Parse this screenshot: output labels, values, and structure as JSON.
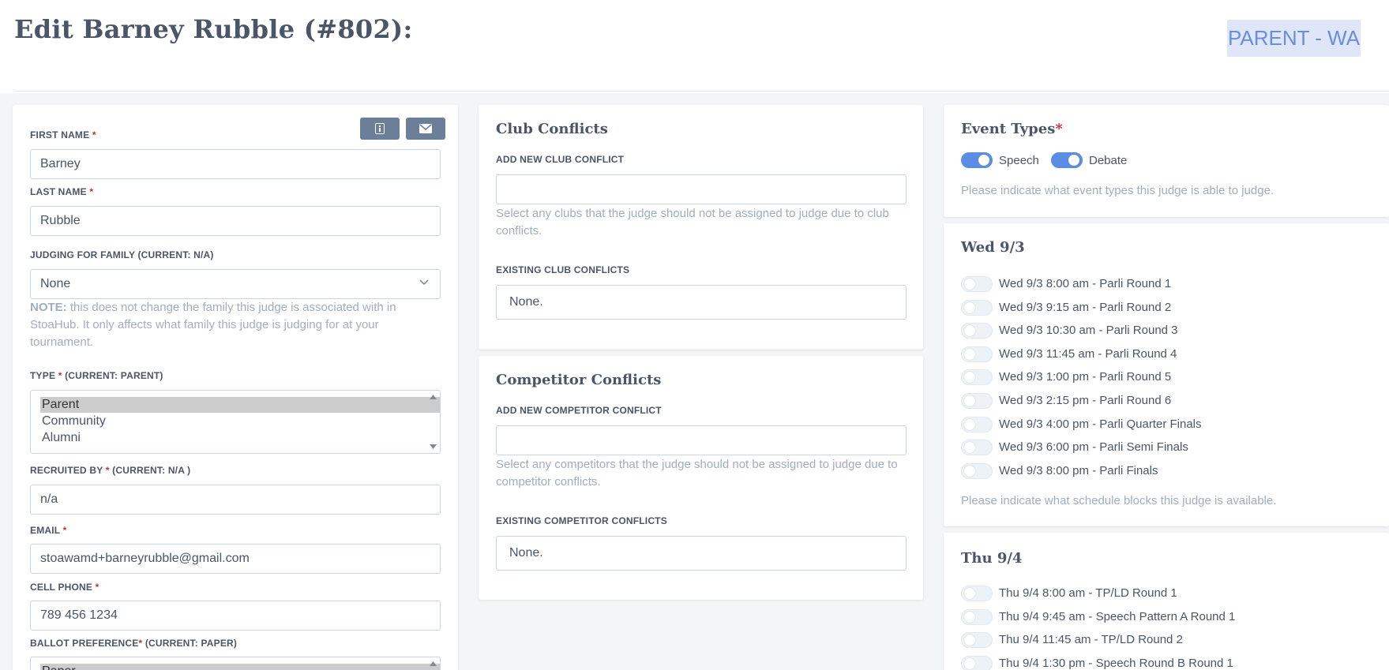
{
  "header": {
    "title": "Edit Barney Rubble (#802):",
    "badge": "PARENT - WA"
  },
  "judge_form": {
    "first_name": {
      "label": "FIRST NAME",
      "required": "*",
      "value": "Barney"
    },
    "last_name": {
      "label": "LAST NAME",
      "required": "*",
      "value": "Rubble"
    },
    "family": {
      "label": "JUDGING FOR FAMILY (CURRENT: N/A)",
      "value": "None"
    },
    "note": {
      "prefix": "NOTE:",
      "text": " this does not change the family this judge is associated with in StoaHub. It only affects what family this judge is judging for at your tournament."
    },
    "type": {
      "label": "TYPE",
      "required": "*",
      "current": " (CURRENT: PARENT)",
      "options": [
        "Parent",
        "Community",
        "Alumni"
      ],
      "selected": "Parent"
    },
    "recruited_by": {
      "label": "RECRUITED BY",
      "required": "*",
      "current": " (CURRENT: N/A )",
      "value": "n/a"
    },
    "email": {
      "label": "EMAIL",
      "required": "*",
      "value": "stoawamd+barneyrubble@gmail.com"
    },
    "cell_phone": {
      "label": "CELL PHONE",
      "required": "*",
      "value": "789 456 1234"
    },
    "ballot_preference": {
      "label": "BALLOT PREFERENCE",
      "required": "*",
      "current": " (CURRENT: PAPER)",
      "selected": "Paper"
    },
    "buttons": {
      "info_icon": "info-icon",
      "mail_icon": "mail-icon"
    }
  },
  "club_conflicts": {
    "title": "Club Conflicts",
    "add_label": "ADD NEW CLUB CONFLICT",
    "add_value": "",
    "help": "Select any clubs that the judge should not be assigned to judge due to club conflicts.",
    "existing_label": "EXISTING CLUB CONFLICTS",
    "existing_value": "None."
  },
  "competitor_conflicts": {
    "title": "Competitor Conflicts",
    "add_label": "ADD NEW COMPETITOR CONFLICT",
    "add_value": "",
    "help": "Select any competitors that the judge should not be assigned to judge due to competitor conflicts.",
    "existing_label": "EXISTING COMPETITOR CONFLICTS",
    "existing_value": "None."
  },
  "event_types": {
    "title": "Event Types",
    "required": "*",
    "items": [
      {
        "label": "Speech",
        "on": true
      },
      {
        "label": "Debate",
        "on": true
      }
    ],
    "help": "Please indicate what event types this judge is able to judge."
  },
  "schedule_wed": {
    "title": "Wed 9/3",
    "blocks": [
      "Wed 9/3 8:00 am - Parli Round 1",
      "Wed 9/3 9:15 am - Parli Round 2",
      "Wed 9/3 10:30 am - Parli Round 3",
      "Wed 9/3 11:45 am - Parli Round 4",
      "Wed 9/3 1:00 pm - Parli Round 5",
      "Wed 9/3 2:15 pm - Parli Round 6",
      "Wed 9/3 4:00 pm - Parli Quarter Finals",
      "Wed 9/3 6:00 pm - Parli Semi Finals",
      "Wed 9/3 8:00 pm - Parli Finals"
    ],
    "help": "Please indicate what schedule blocks this judge is available."
  },
  "schedule_thu": {
    "title": "Thu 9/4",
    "blocks": [
      "Thu 9/4 8:00 am - TP/LD Round 1",
      "Thu 9/4 9:45 am - Speech Pattern A Round 1",
      "Thu 9/4 11:45 am - TP/LD Round 2",
      "Thu 9/4 1:30 pm - Speech Round B Round 1"
    ]
  }
}
